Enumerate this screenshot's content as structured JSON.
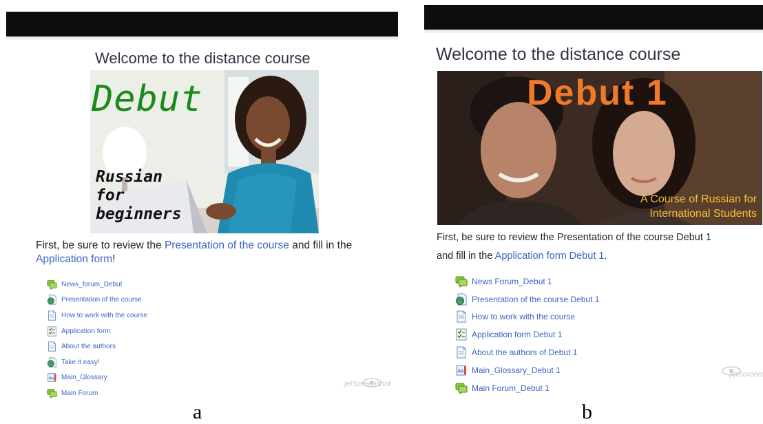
{
  "panels": {
    "a": {
      "caption": "a",
      "welcome": "Welcome to the distance course",
      "banner": {
        "title": "Debut",
        "subtitle_lines": [
          "Russian",
          "for",
          "beginners"
        ]
      },
      "intro": {
        "before_link1": "First, be sure to review the ",
        "link1": "Presentation of the course",
        "between": " and fill in the ",
        "link2": "Application form",
        "after": "!"
      },
      "activities": [
        {
          "label": "News_forum_Debut",
          "icon": "forum-icon"
        },
        {
          "label": "Presentation of the course",
          "icon": "globe-page-icon"
        },
        {
          "label": "How to work with the course",
          "icon": "page-icon"
        },
        {
          "label": "Application form",
          "icon": "feedback-form-icon"
        },
        {
          "label": "About the authors",
          "icon": "page-icon"
        },
        {
          "label": "Take it easy!",
          "icon": "globe-page-icon"
        },
        {
          "label": "Main_Glossary",
          "icon": "glossary-icon"
        },
        {
          "label": "Main Forum",
          "icon": "forum-icon"
        }
      ],
      "watermark": "jetScreenshot"
    },
    "b": {
      "caption": "b",
      "welcome": "Welcome to the distance course",
      "banner": {
        "title": "Debut 1",
        "subtitle_lines": [
          "A Course of Russian for",
          "International Students"
        ]
      },
      "intro": {
        "line1": "First, be sure to review the Presentation of the course Debut 1",
        "before_link": "and fill in the ",
        "link": "Application form Debut 1",
        "after": "."
      },
      "activities": [
        {
          "label": "News Forum_Debut 1",
          "icon": "forum-icon"
        },
        {
          "label": "Presentation of the course Debut 1",
          "icon": "globe-page-icon"
        },
        {
          "label": "How to work with the course",
          "icon": "page-icon"
        },
        {
          "label": "Application form Debut 1",
          "icon": "feedback-form-icon"
        },
        {
          "label": "About the authors of Debut 1",
          "icon": "page-icon"
        },
        {
          "label": "Main_Glossary_Debut 1",
          "icon": "glossary-icon"
        },
        {
          "label": "Main Forum_Debut 1",
          "icon": "forum-icon"
        }
      ],
      "watermark": "jetScreenshot"
    }
  },
  "colors": {
    "link": "#3d63c6",
    "topbar": "#0d0d0d",
    "banner_a_title": "#1a8a1a",
    "banner_b_title": "#f07a2a",
    "banner_b_subtitle": "#f2c23a"
  }
}
